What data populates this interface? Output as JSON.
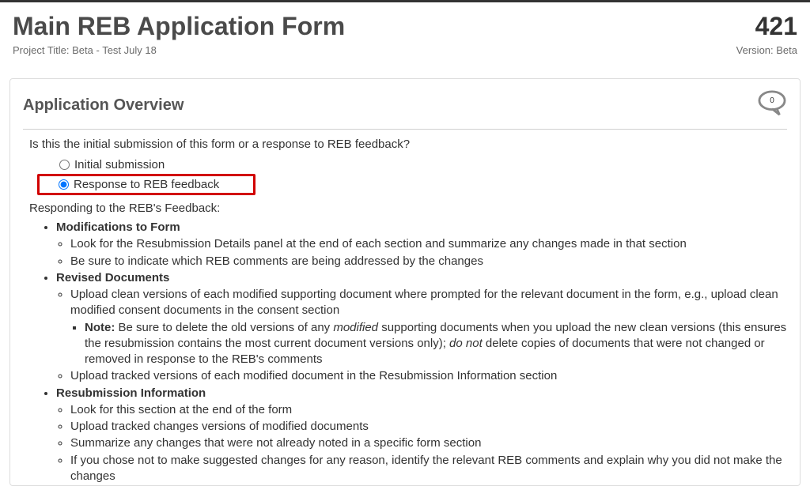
{
  "header": {
    "title": "Main REB Application Form",
    "form_number": "421",
    "project_title_label": "Project Title: Beta - Test July 18",
    "version_label": "Version: Beta"
  },
  "panel": {
    "title": "Application Overview",
    "comment_count": "0",
    "question": "Is this the initial submission of this form or a response to REB feedback?",
    "options": {
      "initial": "Initial submission",
      "response": "Response to REB feedback"
    },
    "feedback_heading": "Responding to the REB's Feedback:"
  },
  "guidance": {
    "modifications": {
      "title": "Modifications to Form",
      "items": [
        "Look for the Resubmission Details panel at the end of each section and summarize any changes made in that section",
        "Be sure to indicate which REB comments are being addressed by the changes"
      ]
    },
    "revised_docs": {
      "title": "Revised Documents",
      "item1": "Upload clean versions of each modified supporting document where prompted for the relevant document in the form, e.g., upload clean modified consent documents in the consent section",
      "note_label": "Note:",
      "note_body_a": " Be sure to delete the old versions of any ",
      "note_modified": "modified",
      "note_body_b": " supporting documents when you upload the new clean versions (this ensures the resubmission contains the most current document versions only); ",
      "note_donot": "do not",
      "note_body_c": " delete copies of documents that were not changed or removed in response to the REB's comments",
      "item2": "Upload tracked versions of each modified document in the Resubmission Information section"
    },
    "resubmission": {
      "title": "Resubmission Information",
      "items": [
        "Look for this section at the end of the form",
        "Upload tracked changes versions of modified documents",
        "Summarize any changes that were not already noted in a specific form section",
        "If you chose not to make suggested changes for any reason, identify the relevant REB comments and explain why you did not make the changes"
      ]
    }
  }
}
